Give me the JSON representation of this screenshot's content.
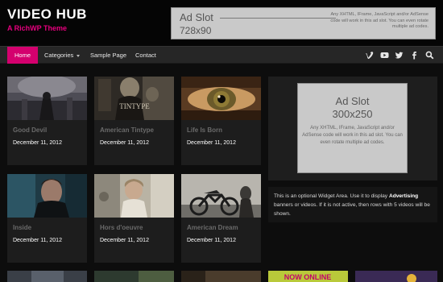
{
  "header": {
    "site_title": "VIDEO HUB",
    "tagline": "A RichWP Theme",
    "ad_banner": {
      "title": "Ad Slot",
      "size": "728x90",
      "description": "Any XHTML, IFrame, JavaScript and/or AdSense code will work in this ad slot. You can even rotate multiple ad codes."
    }
  },
  "nav": {
    "items": [
      {
        "label": "Home",
        "active": true
      },
      {
        "label": "Categories",
        "has_dropdown": true
      },
      {
        "label": "Sample Page"
      },
      {
        "label": "Contact"
      }
    ],
    "social": [
      "vimeo-icon",
      "youtube-icon",
      "twitter-icon",
      "facebook-icon",
      "search-icon"
    ]
  },
  "videos": [
    {
      "title": "Good Devil",
      "date": "December 11, 2012"
    },
    {
      "title": "American Tintype",
      "date": "December 11, 2012"
    },
    {
      "title": "Life Is Born",
      "date": "December 11, 2012"
    },
    {
      "title": "Inside",
      "date": "December 11, 2012"
    },
    {
      "title": "Hors d'oeuvre",
      "date": "December 11, 2012"
    },
    {
      "title": "American Dream",
      "date": "December 11, 2012"
    }
  ],
  "thumb_overlay": {
    "tintype": "TINTYPE"
  },
  "sidebar": {
    "ad_box": {
      "title": "Ad Slot",
      "size": "300x250",
      "description": "Any XHTML, IFrame, JavaScript and/or AdSense code will work in this ad slot. You can even rotate multiple ad codes."
    },
    "widget": {
      "text_before": "This is an optional Widget Area. Use it to display ",
      "bold": "Advertising",
      "text_after": " banners or videos. If it is not active, then rows with 5 videos will be shown."
    }
  },
  "bottom_strip_text": "NOW ONLINE",
  "colors": {
    "accent": "#d4006e",
    "tagline": "#e8007f",
    "background": "#0d0d0d"
  }
}
